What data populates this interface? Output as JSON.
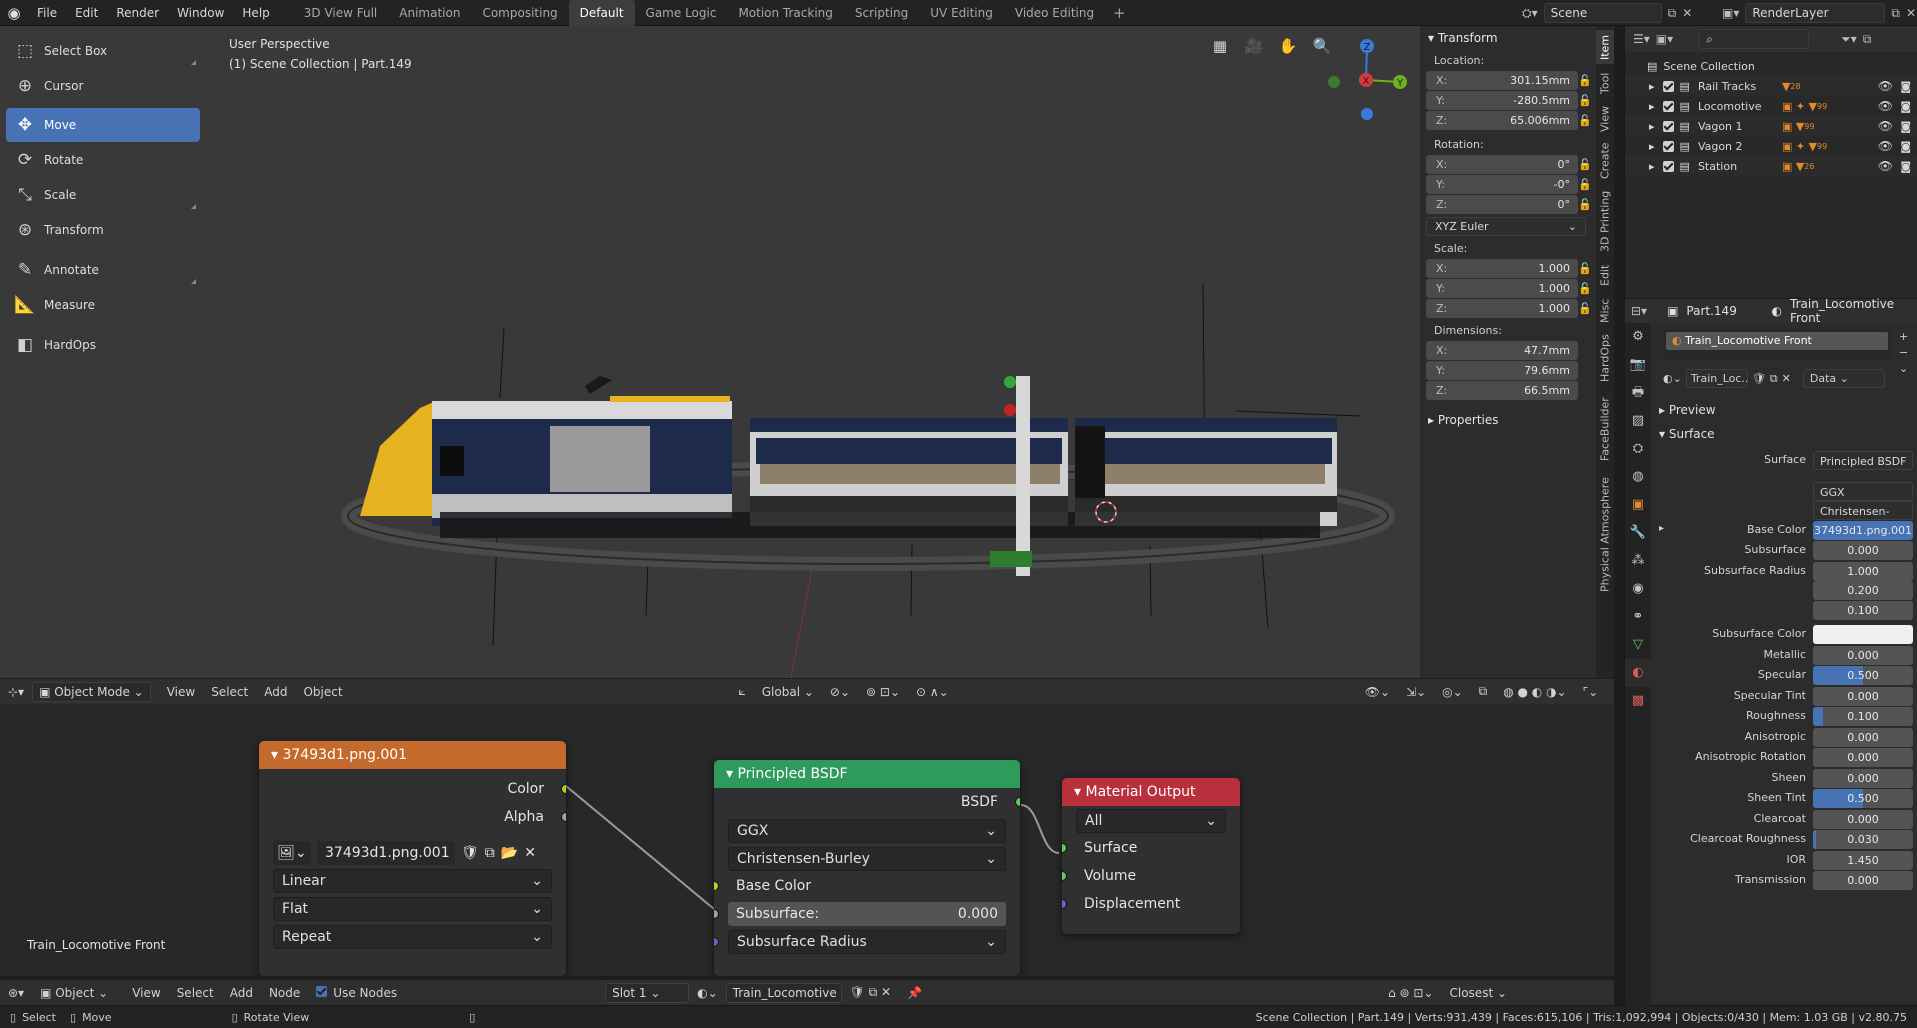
{
  "topbar": {
    "menus": [
      "File",
      "Edit",
      "Render",
      "Window",
      "Help"
    ],
    "workspaces": [
      "3D View Full",
      "Animation",
      "Compositing",
      "Default",
      "Game Logic",
      "Motion Tracking",
      "Scripting",
      "UV Editing",
      "Video Editing"
    ],
    "active_workspace": "Default",
    "add_symbol": "+",
    "scene": "Scene",
    "render_layer": "RenderLayer"
  },
  "toolbar": {
    "tools": [
      {
        "label": "Select Box",
        "icon": "select-box-icon"
      },
      {
        "label": "Cursor",
        "icon": "cursor-icon"
      },
      {
        "label": "Move",
        "icon": "move-icon"
      },
      {
        "label": "Rotate",
        "icon": "rotate-icon"
      },
      {
        "label": "Scale",
        "icon": "scale-icon"
      },
      {
        "label": "Transform",
        "icon": "transform-icon"
      },
      {
        "label": "Annotate",
        "icon": "annotate-icon"
      },
      {
        "label": "Measure",
        "icon": "measure-icon"
      },
      {
        "label": "HardOps",
        "icon": "hardops-icon"
      }
    ],
    "active_tool": "Move"
  },
  "viewport": {
    "perspective": "User Perspective",
    "collection": "(1) Scene Collection | Part.149",
    "gizmo": {
      "x": "X",
      "y": "Y",
      "z": "Z"
    }
  },
  "npanel": {
    "transform_title": "Transform",
    "location_label": "Location:",
    "location": [
      {
        "k": "X:",
        "v": "301.15mm"
      },
      {
        "k": "Y:",
        "v": "-280.5mm"
      },
      {
        "k": "Z:",
        "v": "65.006mm"
      }
    ],
    "rotation_label": "Rotation:",
    "rotation": [
      {
        "k": "X:",
        "v": "0°"
      },
      {
        "k": "Y:",
        "v": "-0°"
      },
      {
        "k": "Z:",
        "v": "0°"
      }
    ],
    "rotation_mode": "XYZ Euler",
    "scale_label": "Scale:",
    "scale": [
      {
        "k": "X:",
        "v": "1.000"
      },
      {
        "k": "Y:",
        "v": "1.000"
      },
      {
        "k": "Z:",
        "v": "1.000"
      }
    ],
    "dimensions_label": "Dimensions:",
    "dimensions": [
      {
        "k": "X:",
        "v": "47.7mm"
      },
      {
        "k": "Y:",
        "v": "79.6mm"
      },
      {
        "k": "Z:",
        "v": "66.5mm"
      }
    ],
    "properties_title": "Properties",
    "tabs": [
      "Item",
      "Tool",
      "View",
      "Create",
      "3D Printing",
      "Edit",
      "Misc",
      "HardOps",
      "FaceBuilder",
      "Physical Atmosphere"
    ]
  },
  "vp_header": {
    "mode": "Object Mode",
    "menus": [
      "View",
      "Select",
      "Add",
      "Object"
    ],
    "orientation": "Global"
  },
  "nodes": {
    "image_node": {
      "title": "37493d1.png.001",
      "outputs": [
        "Color",
        "Alpha"
      ],
      "image_name": "37493d1.png.001",
      "interpolation": "Linear",
      "projection": "Flat",
      "extension": "Repeat"
    },
    "bsdf_node": {
      "title": "Principled BSDF",
      "output": "BSDF",
      "distribution": "GGX",
      "subsurface_method": "Christensen-Burley",
      "base_color": "Base Color",
      "subsurface_label": "Subsurface:",
      "subsurface_value": "0.000",
      "subsurface_radius": "Subsurface Radius"
    },
    "output_node": {
      "title": "Material Output",
      "target": "All",
      "inputs": [
        "Surface",
        "Volume",
        "Displacement"
      ]
    },
    "material_label": "Train_Locomotive Front"
  },
  "ne_header": {
    "mode": "Object",
    "menus": [
      "View",
      "Select",
      "Add",
      "Node"
    ],
    "use_nodes": "Use Nodes",
    "slot": "Slot 1",
    "material": "Train_Locomotive F...",
    "interp": "Closest"
  },
  "statusbar": {
    "select": "Select",
    "move": "Move",
    "rotate": "Rotate View",
    "stats": "Scene Collection | Part.149 | Verts:931,439 | Faces:615,106 | Tris:1,092,994 | Objects:0/430 | Mem: 1.03 GB | v2.80.75"
  },
  "outliner": {
    "root": "Scene Collection",
    "items": [
      "Rail Tracks",
      "Locomotive",
      "Vagon 1",
      "Vagon 2",
      "Station"
    ],
    "badges": [
      "28",
      "99",
      "99",
      "99",
      "26"
    ]
  },
  "props": {
    "object": "Part.149",
    "material": "Train_Locomotive Front",
    "slot_name": "Train_Locomotive Front",
    "mat_short": "Train_Loc...",
    "link": "Data",
    "preview": "Preview",
    "surface_section": "Surface",
    "rows": [
      {
        "label": "Surface",
        "value": "Principled BSDF",
        "kind": "dark"
      },
      {
        "label": "",
        "value": "GGX",
        "kind": "dark"
      },
      {
        "label": "",
        "value": "Christensen-Burley",
        "kind": "dark"
      },
      {
        "label": "Base Color",
        "value": "37493d1.png.001",
        "kind": "blue"
      },
      {
        "label": "Subsurface",
        "value": "0.000",
        "kind": "num",
        "fill": 0
      },
      {
        "label": "Subsurface Radius",
        "value": "1.000",
        "kind": "num",
        "fill": 0
      },
      {
        "label": "",
        "value": "0.200",
        "kind": "num",
        "fill": 0
      },
      {
        "label": "",
        "value": "0.100",
        "kind": "num",
        "fill": 0
      },
      {
        "label": "Subsurface Color",
        "value": "",
        "kind": "white"
      },
      {
        "label": "Metallic",
        "value": "0.000",
        "kind": "num",
        "fill": 0
      },
      {
        "label": "Specular",
        "value": "0.500",
        "kind": "num",
        "fill": 0.5
      },
      {
        "label": "Specular Tint",
        "value": "0.000",
        "kind": "num",
        "fill": 0
      },
      {
        "label": "Roughness",
        "value": "0.100",
        "kind": "num",
        "fill": 0.1
      },
      {
        "label": "Anisotropic",
        "value": "0.000",
        "kind": "num",
        "fill": 0
      },
      {
        "label": "Anisotropic Rotation",
        "value": "0.000",
        "kind": "num",
        "fill": 0
      },
      {
        "label": "Sheen",
        "value": "0.000",
        "kind": "num",
        "fill": 0
      },
      {
        "label": "Sheen Tint",
        "value": "0.500",
        "kind": "num",
        "fill": 0.5
      },
      {
        "label": "Clearcoat",
        "value": "0.000",
        "kind": "num",
        "fill": 0
      },
      {
        "label": "Clearcoat Roughness",
        "value": "0.030",
        "kind": "num",
        "fill": 0.03
      },
      {
        "label": "IOR",
        "value": "1.450",
        "kind": "num",
        "fill": 0
      },
      {
        "label": "Transmission",
        "value": "0.000",
        "kind": "num",
        "fill": 0
      }
    ]
  },
  "colors": {
    "accent": "#4772b3",
    "image_node_header": "#c46a2c",
    "bsdf_node_header": "#2e9b5c",
    "output_node_header": "#b8303b"
  }
}
